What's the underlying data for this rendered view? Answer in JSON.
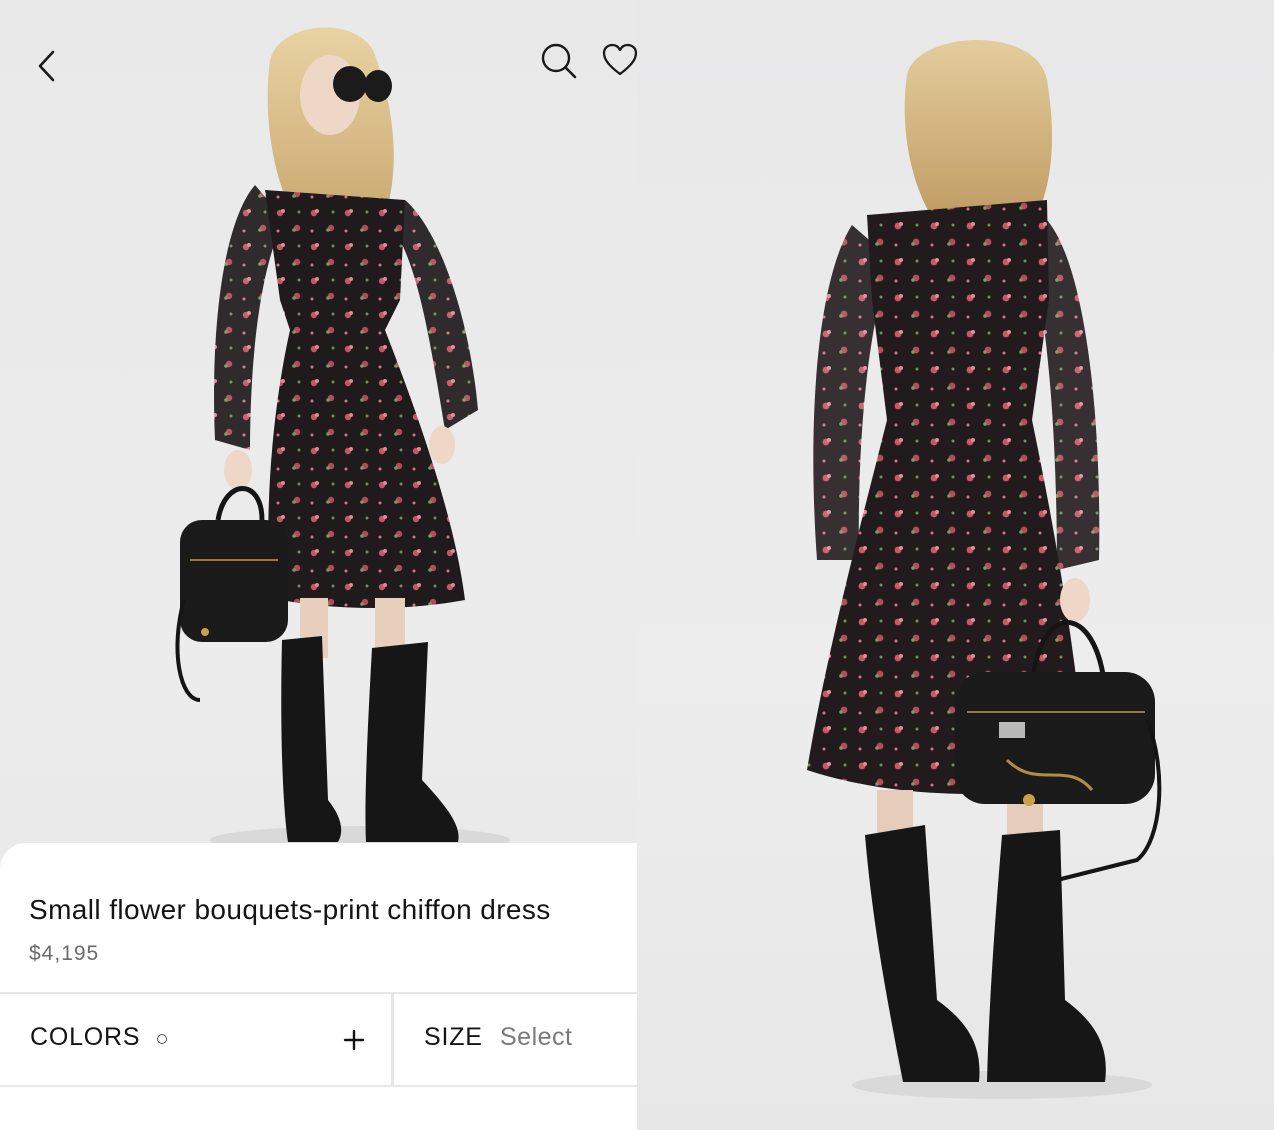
{
  "product": {
    "title": "Small flower bouquets-print chiffon dress",
    "price": "$4,195"
  },
  "options": {
    "colors_label": "COLORS",
    "size_label": "SIZE",
    "size_value": "Select"
  },
  "icons": {
    "back": "chevron-left-icon",
    "search": "search-icon",
    "wishlist": "heart-icon",
    "add_color": "plus-icon"
  },
  "colors": {
    "background": "#ebebec",
    "sheet": "#ffffff",
    "text": "#141414",
    "muted": "#6b6b6b"
  }
}
